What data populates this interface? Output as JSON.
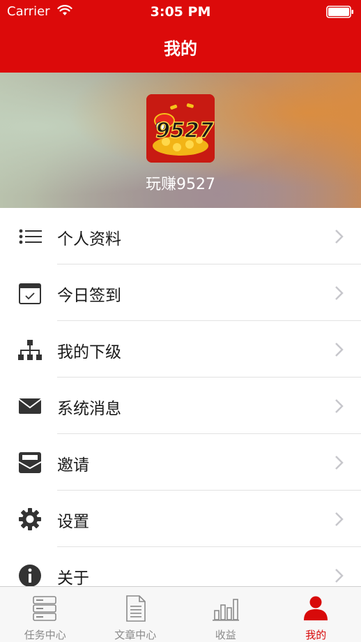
{
  "status_bar": {
    "carrier": "Carrier",
    "time": "3:05 PM"
  },
  "nav": {
    "title": "我的"
  },
  "profile": {
    "username": "玩赚9527",
    "avatar_text": "9527"
  },
  "menu": {
    "items": [
      {
        "label": "个人资料",
        "icon": "list-icon"
      },
      {
        "label": "今日签到",
        "icon": "calendar-check-icon"
      },
      {
        "label": "我的下级",
        "icon": "org-tree-icon"
      },
      {
        "label": "系统消息",
        "icon": "envelope-icon"
      },
      {
        "label": "邀请",
        "icon": "open-mail-icon"
      },
      {
        "label": "设置",
        "icon": "gear-icon"
      },
      {
        "label": "关于",
        "icon": "info-icon"
      }
    ]
  },
  "tabbar": {
    "items": [
      {
        "label": "任务中心",
        "icon": "server-icon"
      },
      {
        "label": "文章中心",
        "icon": "document-icon"
      },
      {
        "label": "收益",
        "icon": "bar-chart-icon"
      },
      {
        "label": "我的",
        "icon": "user-icon",
        "active": true
      }
    ]
  },
  "colors": {
    "primary": "#dc0a0a",
    "tab_inactive": "#8a8a8a",
    "tab_active": "#d80a0a"
  }
}
